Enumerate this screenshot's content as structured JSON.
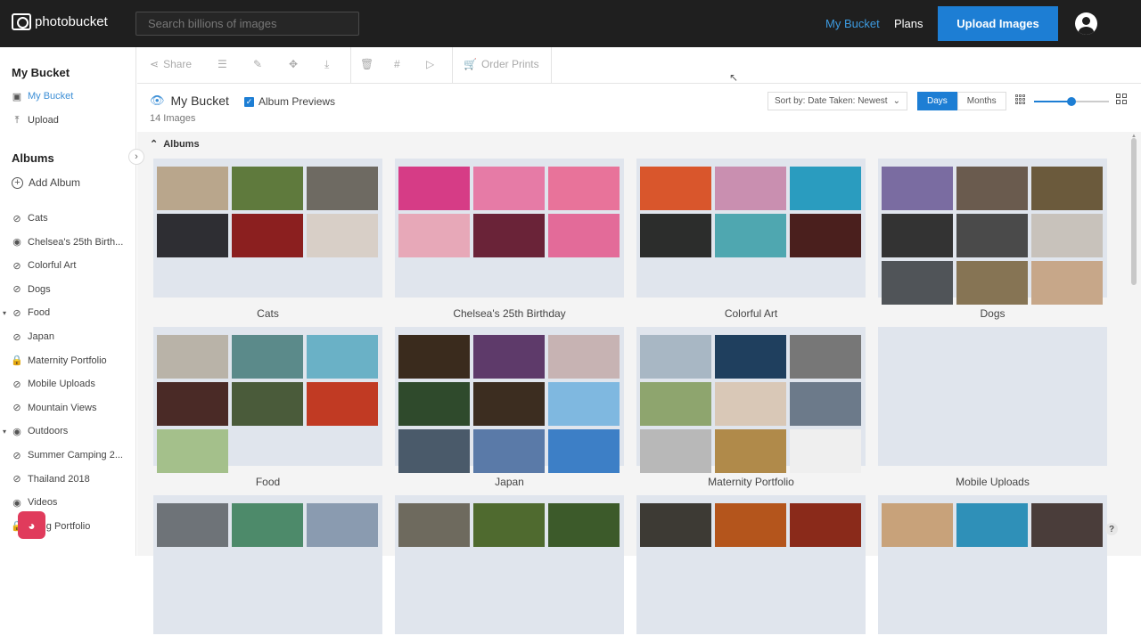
{
  "header": {
    "logo_text": "photobucket",
    "search_placeholder": "Search billions of images",
    "nav": {
      "my_bucket": "My Bucket",
      "plans": "Plans"
    },
    "upload_label": "Upload Images"
  },
  "sidebar": {
    "heading": "My Bucket",
    "items": [
      {
        "label": "My Bucket",
        "icon": "image-icon"
      },
      {
        "label": "Upload",
        "icon": "upload-icon"
      }
    ],
    "albums_heading": "Albums",
    "add_album": "Add Album",
    "albums": [
      {
        "label": "Cats",
        "icon": "eye-slash-icon"
      },
      {
        "label": "Chelsea's 25th Birth...",
        "icon": "eye-icon"
      },
      {
        "label": "Colorful Art",
        "icon": "eye-slash-icon"
      },
      {
        "label": "Dogs",
        "icon": "eye-slash-icon"
      },
      {
        "label": "Food",
        "icon": "eye-slash-icon",
        "expandable": true
      },
      {
        "label": "Japan",
        "icon": "eye-slash-icon"
      },
      {
        "label": "Maternity Portfolio",
        "icon": "lock-icon"
      },
      {
        "label": "Mobile Uploads",
        "icon": "eye-slash-icon"
      },
      {
        "label": "Mountain Views",
        "icon": "eye-slash-icon"
      },
      {
        "label": "Outdoors",
        "icon": "eye-icon",
        "expandable": true
      },
      {
        "label": "Summer Camping 2...",
        "icon": "eye-slash-icon"
      },
      {
        "label": "Thailand 2018",
        "icon": "eye-slash-icon"
      },
      {
        "label": "Videos",
        "icon": "eye-icon"
      },
      {
        "label": "dding Portfolio",
        "icon": "lock-icon"
      }
    ]
  },
  "toolbar": {
    "share": "Share",
    "order_prints": "Order Prints"
  },
  "content": {
    "title": "My Bucket",
    "album_previews": "Album Previews",
    "image_count": "14 Images",
    "sort_label": "Sort by: Date Taken: Newest",
    "view_days": "Days",
    "view_months": "Months",
    "zoom_level": 0.5,
    "albums_label": "Albums"
  },
  "albums": [
    {
      "name": "Cats",
      "thumbs": [
        "#b9a68c",
        "#5f7a3d",
        "#6e6a62",
        "#2e2e33",
        "#8b1f1f",
        "#d8cfc7"
      ]
    },
    {
      "name": "Chelsea's 25th Birthday",
      "thumbs": [
        "#d63c86",
        "#e67ba6",
        "#e8739a",
        "#e7a8b8",
        "#6a2338",
        "#e36b99"
      ]
    },
    {
      "name": "Colorful Art",
      "thumbs": [
        "#d9562c",
        "#c98fb0",
        "#2a9cbf",
        "#2c2d2c",
        "#4fa7b0",
        "#4a1f1d"
      ]
    },
    {
      "name": "Dogs",
      "thumbs": [
        "#7a6ca1",
        "#6a5b4e",
        "#6b5a3c",
        "#333333",
        "#4a4a4a",
        "#c8c2bb",
        "#505458",
        "#867454",
        "#c7a789"
      ]
    },
    {
      "name": "Food",
      "thumbs": [
        "#b9b3a8",
        "#5b8a8a",
        "#6ab1c6",
        "#4a2a26",
        "#4a5b3a",
        "#c13a23",
        "#a4c08b"
      ]
    },
    {
      "name": "Japan",
      "thumbs": [
        "#3a2b1d",
        "#5e3a6a",
        "#c7b3b3",
        "#2f4a2c",
        "#3c2d20",
        "#7fb8e0",
        "#4a5a6a",
        "#5a7aa8",
        "#3d7fc6"
      ]
    },
    {
      "name": "Maternity Portfolio",
      "thumbs": [
        "#a8b7c4",
        "#1f3f5e",
        "#777777",
        "#8ea56e",
        "#d9c8b7",
        "#6c7a8a",
        "#b8b8b8",
        "#b08a4a",
        "#efefef"
      ]
    },
    {
      "name": "Mobile Uploads",
      "thumbs": []
    },
    {
      "name": "",
      "thumbs": [
        "#6e7378",
        "#4d8a6a",
        "#8a9bb0"
      ]
    },
    {
      "name": "",
      "thumbs": [
        "#6e6a5e",
        "#4f6a2f",
        "#3c5a2a"
      ]
    },
    {
      "name": "",
      "thumbs": [
        "#3d3a34",
        "#b4551c",
        "#8a2a1a"
      ]
    },
    {
      "name": "",
      "thumbs": [
        "#c8a27a",
        "#2f90b8",
        "#4a3d3a"
      ]
    }
  ]
}
